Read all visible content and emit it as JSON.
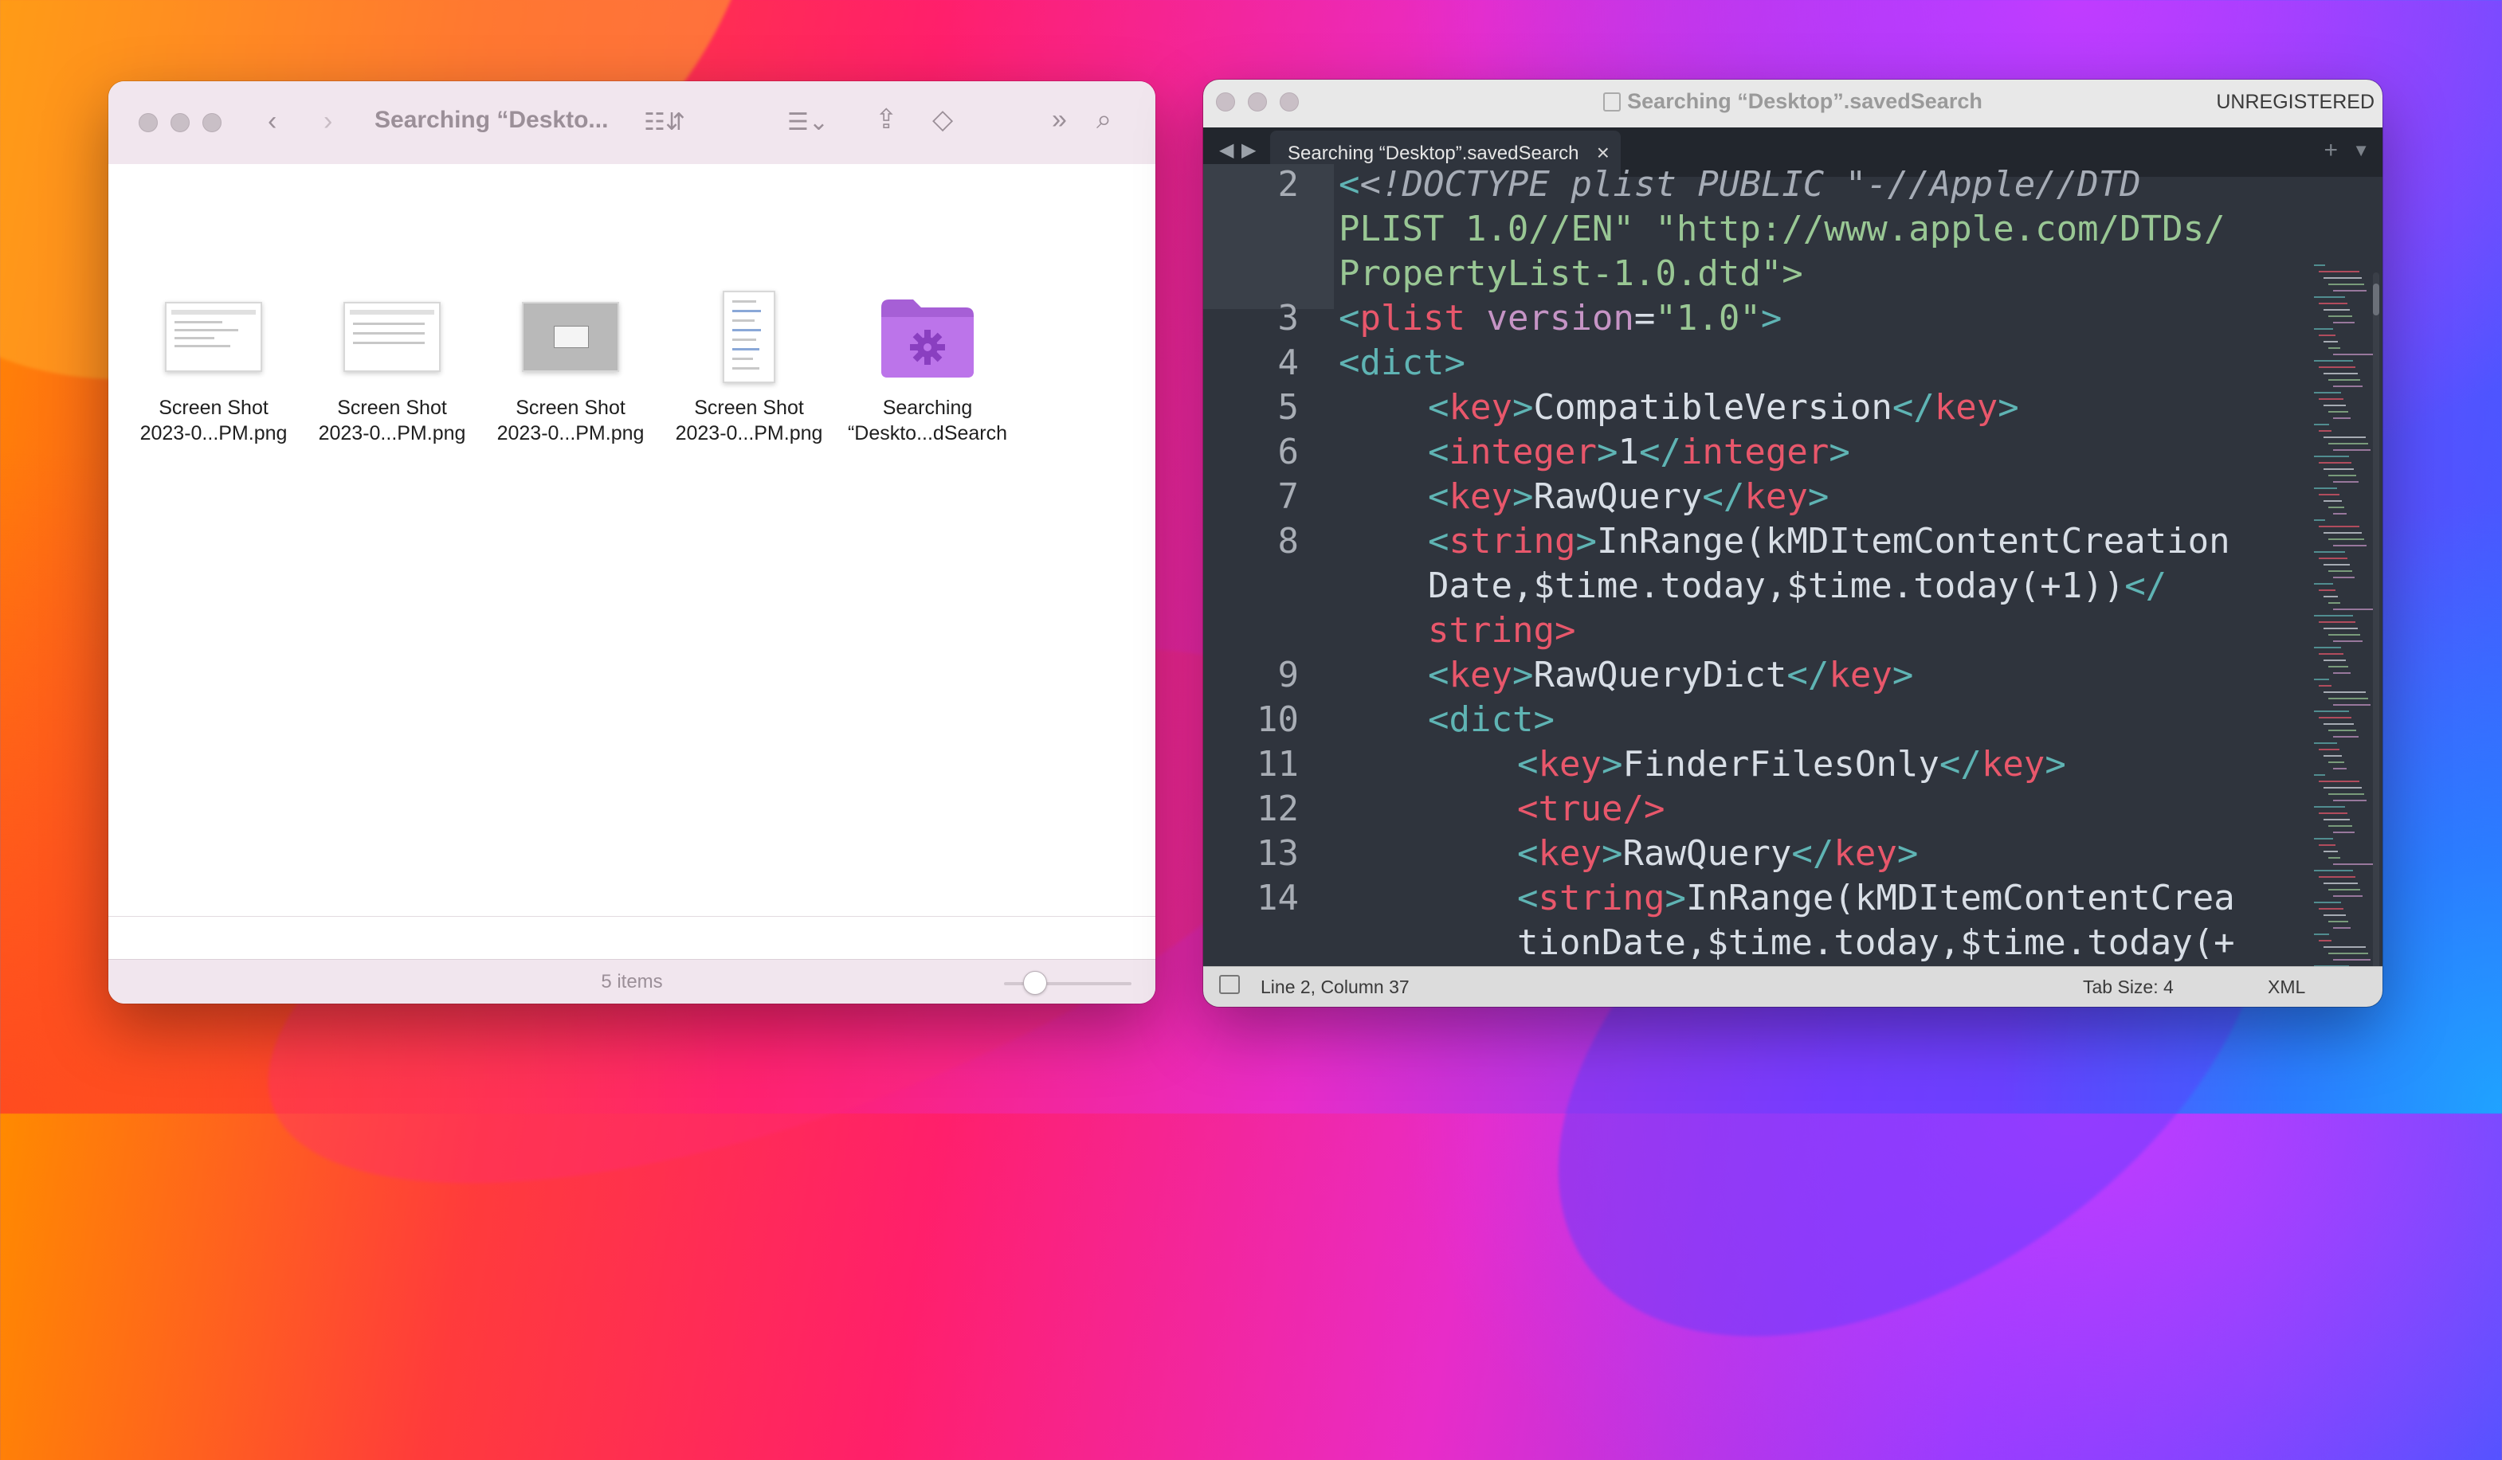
{
  "finder": {
    "title": "Searching “Deskto...",
    "items": [
      {
        "line1": "Screen Shot",
        "line2": "2023-0...PM.png",
        "icon": "screenshot-thumbnail-icon"
      },
      {
        "line1": "Screen Shot",
        "line2": "2023-0...PM.png",
        "icon": "screenshot-thumbnail-icon"
      },
      {
        "line1": "Screen Shot",
        "line2": "2023-0...PM.png",
        "icon": "screenshot-thumbnail-icon"
      },
      {
        "line1": "Screen Shot",
        "line2": "2023-0...PM.png",
        "icon": "screenshot-thumbnail-icon"
      },
      {
        "line1": "Searching",
        "line2": "“Deskto...dSearch",
        "icon": "smart-folder-icon"
      }
    ],
    "status": "5 items",
    "icon_size_fraction": 0.17,
    "colors": {
      "toolbar": "#f1e6ee",
      "folder": "#b76ee0"
    }
  },
  "editor": {
    "window_title": "Searching “Desktop”.savedSearch",
    "registration": "UNREGISTERED",
    "tab_label": "Searching “Desktop”.savedSearch",
    "lines": [
      {
        "num": "2",
        "wrapped": [
          "<!DOCTYPE plist PUBLIC \"-//Apple//DTD",
          "PLIST 1.0//EN\" \"http://www.apple.com/DTDs/",
          "PropertyList-1.0.dtd\">"
        ]
      },
      {
        "num": "3",
        "text": "<plist version=\"1.0\">"
      },
      {
        "num": "4",
        "text": "<dict>"
      },
      {
        "num": "5",
        "text": "<key>CompatibleVersion</key>"
      },
      {
        "num": "6",
        "text": "<integer>1</integer>"
      },
      {
        "num": "7",
        "text": "<key>RawQuery</key>"
      },
      {
        "num": "8",
        "wrapped": [
          "<string>InRange(kMDItemContentCreation",
          "Date,$time.today,$time.today(+1))</",
          "string>"
        ]
      },
      {
        "num": "9",
        "text": "<key>RawQueryDict</key>"
      },
      {
        "num": "10",
        "text": "<dict>"
      },
      {
        "num": "11",
        "text": "<key>FinderFilesOnly</key>"
      },
      {
        "num": "12",
        "text": "<true/>"
      },
      {
        "num": "13",
        "text": "<key>RawQuery</key>"
      },
      {
        "num": "14",
        "wrapped": [
          "<string>InRange(kMDItemContentCrea",
          "tionDate,$time.today,$time.today(+"
        ]
      }
    ],
    "status": {
      "position": "Line 2, Column 37",
      "tab_size": "Tab Size: 4",
      "syntax": "XML"
    },
    "colors": {
      "background": "#2f343d",
      "tag": "#5fb4b4",
      "keyword": "#e8576b",
      "attribute": "#c594c5",
      "string": "#99c794"
    }
  }
}
